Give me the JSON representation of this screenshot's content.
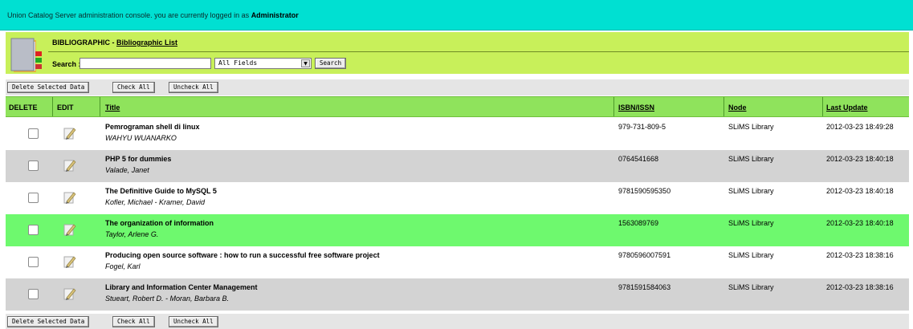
{
  "header": {
    "text_prefix": "Union Catalog Server administration console. you are currently logged in as",
    "user": "Administrator"
  },
  "section": {
    "module": "BIBLIOGRAPHIC",
    "sep": " - ",
    "page_link": "Bibliographic List",
    "search_label": "Search :",
    "search_value": "",
    "field_select": "All Fields",
    "search_button": "Search"
  },
  "toolbar": {
    "delete_selected": "Delete Selected Data",
    "check_all": "Check All",
    "uncheck_all": "Uncheck All"
  },
  "table": {
    "headers": {
      "delete": "DELETE",
      "edit": "EDIT",
      "title": "Title",
      "isbn": "ISBN/ISSN",
      "node": "Node",
      "last_update": "Last Update"
    },
    "rows": [
      {
        "title": "Pemrograman shell di linux",
        "author": "WAHYU WUANARKO",
        "isbn": "979-731-809-5",
        "node": "SLiMS Library",
        "updated": "2012-03-23 18:49:28"
      },
      {
        "title": "PHP 5 for dummies",
        "author": "Valade, Janet",
        "isbn": "0764541668",
        "node": "SLiMS Library",
        "updated": "2012-03-23 18:40:18"
      },
      {
        "title": "The Definitive Guide to MySQL 5",
        "author": "Kofler, Michael - Kramer, David",
        "isbn": "9781590595350",
        "node": "SLiMS Library",
        "updated": "2012-03-23 18:40:18"
      },
      {
        "title": "The organization of information",
        "author": "Taylor, Arlene G.",
        "isbn": "1563089769",
        "node": "SLiMS Library",
        "updated": "2012-03-23 18:40:18"
      },
      {
        "title": "Producing open source software : how to run a successful free software project",
        "author": "Fogel, Karl",
        "isbn": "9780596007591",
        "node": "SLiMS Library",
        "updated": "2012-03-23 18:38:16"
      },
      {
        "title": "Library and Information Center Management",
        "author": "Stueart, Robert D. - Moran, Barbara B.",
        "isbn": "9781591584063",
        "node": "SLiMS Library",
        "updated": "2012-03-23 18:38:16"
      }
    ]
  },
  "colors": {
    "header_bg": "#00e0d2",
    "section_bg": "#c8f05a",
    "table_header_bg": "#8fe35c",
    "row_gray": "#d3d3d3",
    "row_highlight": "#6ef96e"
  }
}
